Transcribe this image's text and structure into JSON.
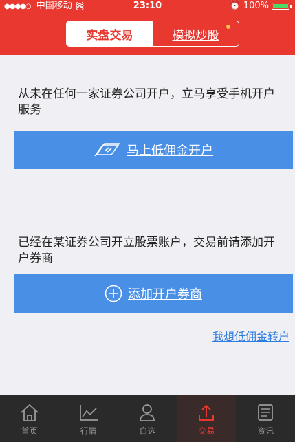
{
  "status_bar": {
    "carrier": "中国移动",
    "time": "23:10",
    "battery_text": "100%",
    "battery_level": 1.0
  },
  "header": {
    "tabs": [
      {
        "label": "实盘交易",
        "active": true
      },
      {
        "label": "模拟炒股",
        "active": false,
        "has_badge": true
      }
    ]
  },
  "section_new": {
    "text": "从未在任何一家证券公司开户，立马享受手机开户服务",
    "button_label": "马上低佣金开户",
    "icon": "money-stack-icon"
  },
  "section_existing": {
    "text": "已经在某证券公司开立股票账户，交易前请添加开户券商",
    "button_label": "添加开户券商",
    "icon": "plus-circle-icon"
  },
  "transfer_link": "我想低佣金转户",
  "tabbar": {
    "items": [
      {
        "label": "首页",
        "icon": "home-icon"
      },
      {
        "label": "行情",
        "icon": "chart-icon"
      },
      {
        "label": "自选",
        "icon": "user-icon"
      },
      {
        "label": "交易",
        "icon": "upload-icon",
        "active": true
      },
      {
        "label": "资讯",
        "icon": "news-icon"
      }
    ]
  },
  "colors": {
    "brand_red": "#e8382f",
    "button_blue": "#4a8fe6",
    "link_blue": "#2f7de0",
    "tabbar_bg": "#2a2a2a"
  }
}
